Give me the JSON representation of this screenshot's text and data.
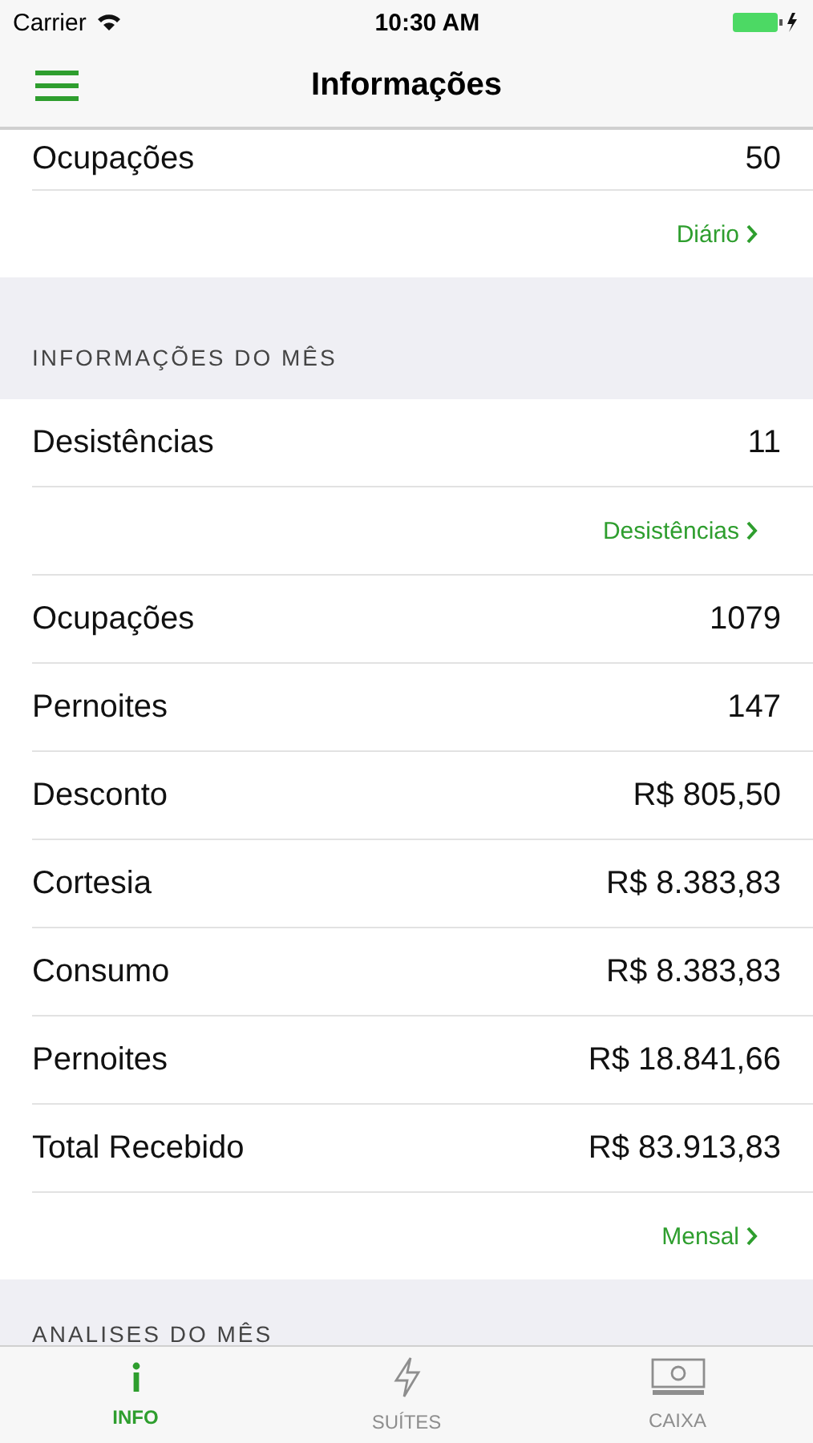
{
  "status_bar": {
    "carrier": "Carrier",
    "time": "10:30 AM"
  },
  "nav": {
    "title": "Informações"
  },
  "sections": [
    {
      "rows": [
        {
          "kind": "value",
          "label": "Ocupações",
          "value": "50"
        },
        {
          "kind": "link",
          "label": "Diário"
        }
      ]
    },
    {
      "header": "INFORMAÇÕES DO MÊS",
      "rows": [
        {
          "kind": "value",
          "label": "Desistências",
          "value": "11"
        },
        {
          "kind": "link",
          "label": "Desistências"
        },
        {
          "kind": "value",
          "label": "Ocupações",
          "value": "1079"
        },
        {
          "kind": "value",
          "label": "Pernoites",
          "value": "147"
        },
        {
          "kind": "value",
          "label": "Desconto",
          "value": "R$ 805,50"
        },
        {
          "kind": "value",
          "label": "Cortesia",
          "value": "R$ 8.383,83"
        },
        {
          "kind": "value",
          "label": "Consumo",
          "value": "R$ 8.383,83"
        },
        {
          "kind": "value",
          "label": "Pernoites",
          "value": "R$ 18.841,66"
        },
        {
          "kind": "value",
          "label": "Total Recebido",
          "value": "R$ 83.913,83"
        },
        {
          "kind": "link",
          "label": "Mensal"
        }
      ]
    },
    {
      "header": "ANALISES DO MÊS"
    }
  ],
  "tabs": [
    {
      "kind": "info",
      "label": "INFO",
      "selected": true
    },
    {
      "kind": "bolt",
      "label": "SUÍTES",
      "selected": false
    },
    {
      "kind": "cash",
      "label": "CAIXA",
      "selected": false
    }
  ]
}
